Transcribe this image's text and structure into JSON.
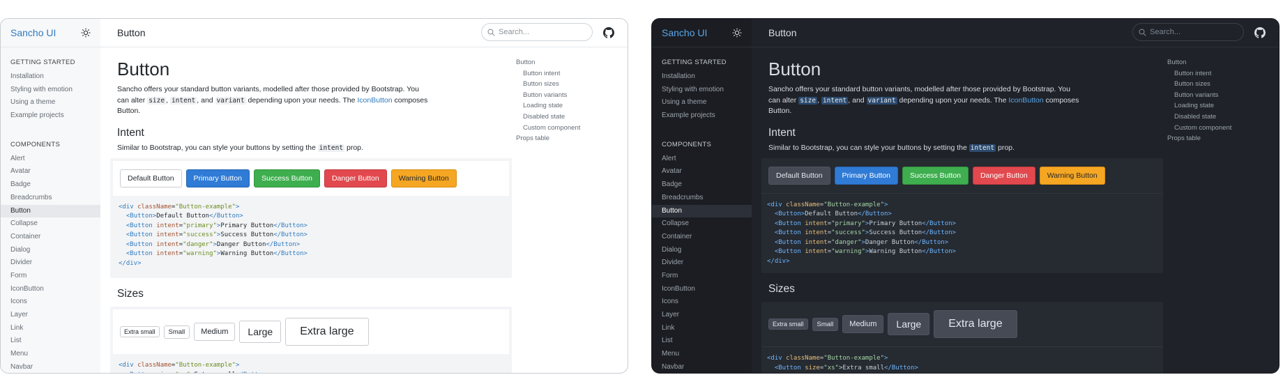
{
  "app": {
    "brand": "Sancho UI",
    "page_title": "Button",
    "search_placeholder": "Search..."
  },
  "sidebar": {
    "getting_started_heading": "GETTING STARTED",
    "getting_started": [
      "Installation",
      "Styling with emotion",
      "Using a theme",
      "Example projects"
    ],
    "components_heading": "COMPONENTS",
    "components": [
      "Alert",
      "Avatar",
      "Badge",
      "Breadcrumbs",
      "Button",
      "Collapse",
      "Container",
      "Dialog",
      "Divider",
      "Form",
      "IconButton",
      "Icons",
      "Layer",
      "Link",
      "List",
      "Menu",
      "Navbar"
    ],
    "active": "Button"
  },
  "content": {
    "h1": "Button",
    "intro_1": "Sancho offers your standard button variants, modelled after those provided by Bootstrap. You can alter ",
    "code_size": "size",
    "sep_1": ", ",
    "code_intent": "intent",
    "sep_2": ", and ",
    "code_variant": "variant",
    "intro_2": " depending upon your needs. The ",
    "link_iconbutton": "IconButton",
    "intro_3": " composes Button.",
    "intent_heading": "Intent",
    "intent_sub_1": "Similar to Bootstrap, you can style your buttons by setting the ",
    "intent_sub_code": "intent",
    "intent_sub_2": " prop.",
    "buttons": [
      "Default Button",
      "Primary Button",
      "Success Button",
      "Danger Button",
      "Warning Button"
    ],
    "code_lines": [
      {
        "indent": "",
        "open": "<div ",
        "attr": "className",
        "eq": "=",
        "val": "\"Button-example\"",
        "rest": ">",
        "text": "",
        "close": ""
      },
      {
        "indent": "  ",
        "open": "<Button",
        "attr": "",
        "eq": "",
        "val": "",
        "rest": ">",
        "text": "Default Button",
        "close": "</Button>"
      },
      {
        "indent": "  ",
        "open": "<Button ",
        "attr": "intent",
        "eq": "=",
        "val": "\"primary\"",
        "rest": ">",
        "text": "Primary Button",
        "close": "</Button>"
      },
      {
        "indent": "  ",
        "open": "<Button ",
        "attr": "intent",
        "eq": "=",
        "val": "\"success\"",
        "rest": ">",
        "text": "Success Button",
        "close": "</Button>"
      },
      {
        "indent": "  ",
        "open": "<Button ",
        "attr": "intent",
        "eq": "=",
        "val": "\"danger\"",
        "rest": ">",
        "text": "Danger Button",
        "close": "</Button>"
      },
      {
        "indent": "  ",
        "open": "<Button ",
        "attr": "intent",
        "eq": "=",
        "val": "\"warning\"",
        "rest": ">",
        "text": "Warning Button",
        "close": "</Button>"
      },
      {
        "indent": "",
        "open": "</div>",
        "attr": "",
        "eq": "",
        "val": "",
        "rest": "",
        "text": "",
        "close": ""
      }
    ],
    "sizes_heading": "Sizes",
    "size_buttons": [
      "Extra small",
      "Small",
      "Medium",
      "Large",
      "Extra large"
    ],
    "sizes_code_1_open": "<div ",
    "sizes_code_1_attr": "className",
    "sizes_code_1_val": "\"Button-example\"",
    "sizes_code_1_rest": ">",
    "sizes_code_2_open": "  <Button ",
    "sizes_code_2_attr": "size",
    "sizes_code_2_val": "\"xs\"",
    "sizes_code_2_text": ">Extra small",
    "sizes_code_2_close": "</Button>"
  },
  "toc": {
    "items": [
      {
        "label": "Button",
        "indent": false
      },
      {
        "label": "Button intent",
        "indent": true
      },
      {
        "label": "Button sizes",
        "indent": true
      },
      {
        "label": "Button variants",
        "indent": true
      },
      {
        "label": "Loading state",
        "indent": true
      },
      {
        "label": "Disabled state",
        "indent": true
      },
      {
        "label": "Custom component",
        "indent": true
      },
      {
        "label": "Props table",
        "indent": false
      }
    ]
  },
  "colors": {
    "primary": "#2f7bd6",
    "success": "#3eae4e",
    "danger": "#e2494e",
    "warning": "#f5a623",
    "brand_link": "#2f7bbf"
  },
  "icons": {
    "theme_toggle": "sun-icon",
    "search": "search-icon",
    "github": "github-icon"
  }
}
